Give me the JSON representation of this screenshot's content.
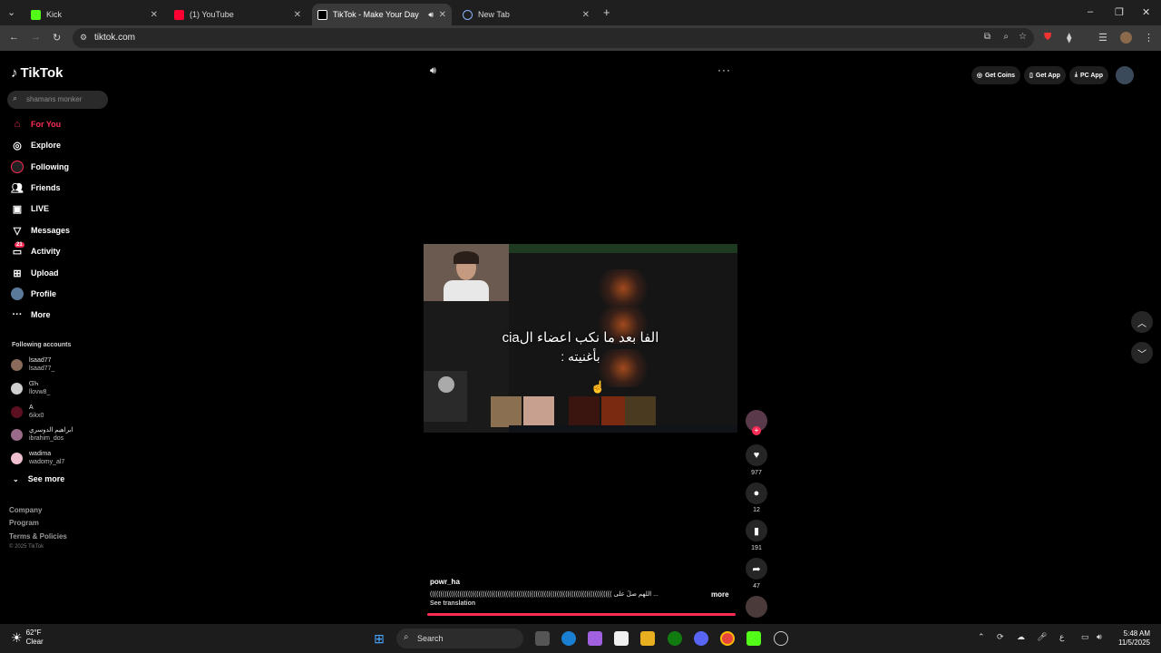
{
  "browser": {
    "tabs": [
      {
        "title": "Kick",
        "color": "#53fc18"
      },
      {
        "title": "(1) YouTube",
        "color": "#ff0033"
      },
      {
        "title": "TikTok - Make Your Day",
        "color": "#ffffff"
      },
      {
        "title": "New Tab",
        "color": "#8ab4f8"
      }
    ],
    "url": "tiktok.com"
  },
  "sidebar": {
    "logo": "TikTok",
    "search_placeholder": "shamans monker",
    "nav": [
      {
        "label": "For You",
        "icon": "home-icon"
      },
      {
        "label": "Explore",
        "icon": "compass-icon"
      },
      {
        "label": "Following",
        "icon": "following-icon"
      },
      {
        "label": "Friends",
        "icon": "friends-icon"
      },
      {
        "label": "LIVE",
        "icon": "live-icon"
      },
      {
        "label": "Messages",
        "icon": "messages-icon"
      },
      {
        "label": "Activity",
        "icon": "activity-icon",
        "badge": "21"
      },
      {
        "label": "Upload",
        "icon": "upload-icon"
      },
      {
        "label": "Profile",
        "icon": "avatar"
      },
      {
        "label": "More",
        "icon": "more-icon"
      }
    ],
    "following_title": "Following accounts",
    "accounts": [
      {
        "name": "lsaad77",
        "handle": "lsaad77_",
        "color": "#8a6a5a"
      },
      {
        "name": "ᏳᏂ",
        "handle": "llovw8_",
        "color": "#cfcfcf"
      },
      {
        "name": "A",
        "handle": "6ikx0",
        "color": "#5a1020"
      },
      {
        "name": "ابراهيم الدوسري",
        "handle": "ibrahim_dos",
        "color": "#9a6a8a"
      },
      {
        "name": "wadima",
        "handle": "wadomy_al7",
        "color": "#f0c0d0"
      }
    ],
    "see_more": "See more",
    "footer": [
      "Company",
      "Program",
      "Terms & Policies"
    ],
    "copyright": "© 2025 TikTok"
  },
  "top_actions": [
    "Get Coins",
    "Get App",
    "PC App"
  ],
  "video": {
    "caption_line1": "الفا بعد ما نكب اعضاء الcia",
    "caption_line2": "بأغنيته :",
    "author": "powr_ha",
    "description": "(((((((((((((((((((((((((((((((((((((((((((((((((((((((((((((((((((((((((((((((((((((( اللهم صلِّ على ...",
    "more": "more",
    "see_translation": "See translation",
    "likes": "977",
    "comments": "12",
    "saves": "191",
    "shares": "47"
  },
  "taskbar": {
    "temp": "62°F",
    "weather": "Clear",
    "search": "Search",
    "time": "5:48 AM",
    "date": "11/5/2025"
  }
}
